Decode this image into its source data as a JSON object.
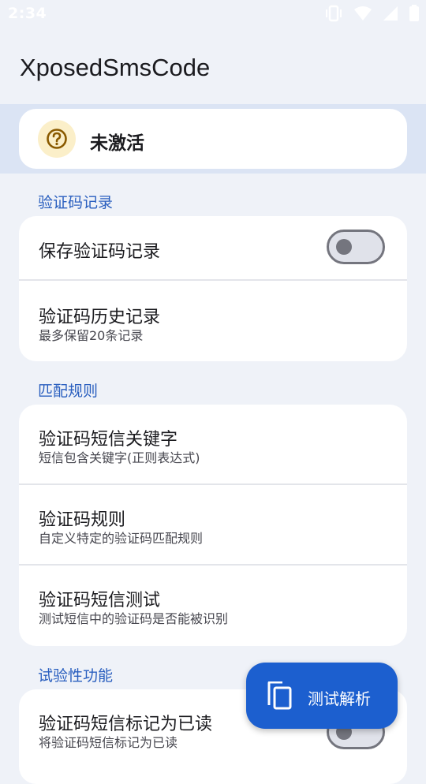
{
  "status_bar": {
    "time": "2:34"
  },
  "app": {
    "title": "XposedSmsCode"
  },
  "status_card": {
    "label": "未激活",
    "icon": "question-circle-icon"
  },
  "sections": [
    {
      "header": "验证码记录",
      "items": [
        {
          "title": "保存验证码记录",
          "toggle": false
        },
        {
          "title": "验证码历史记录",
          "subtitle": "最多保留20条记录"
        }
      ]
    },
    {
      "header": "匹配规则",
      "items": [
        {
          "title": "验证码短信关键字",
          "subtitle": "短信包含关键字(正则表达式)"
        },
        {
          "title": "验证码规则",
          "subtitle": "自定义特定的验证码匹配规则"
        },
        {
          "title": "验证码短信测试",
          "subtitle": "测试短信中的验证码是否能被识别"
        }
      ]
    },
    {
      "header": "试验性功能",
      "items": [
        {
          "title": "验证码短信标记为已读",
          "subtitle": "将验证码短信标记为已读",
          "toggle": false
        }
      ]
    }
  ],
  "fab": {
    "label": "测试解析",
    "icon": "copy-icon"
  },
  "colors": {
    "accent": "#1c5fcf",
    "section_header": "#2a5fbf",
    "status_icon_bg": "#fbefc9",
    "status_icon_fg": "#8a5a00"
  }
}
